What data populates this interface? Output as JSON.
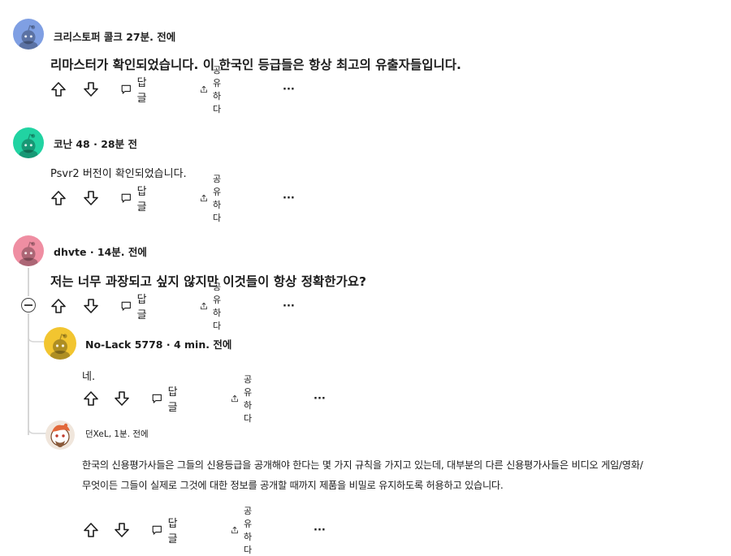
{
  "comments": [
    {
      "author": "크리스토퍼 콜크",
      "meta": "27분. 전에",
      "body": "리마스터가 확인되었습니다. 이 한국인 등급들은 항상 최고의 유출자들입니다.",
      "avatar_color": "#7f9fe3",
      "actions": {
        "reply": "답글",
        "share": "공유하다",
        "more": "···"
      }
    },
    {
      "author": "코난 48",
      "meta": "· 28분 전",
      "body": "Psvr2 버전이 확인되었습니다.",
      "avatar_color": "#21d3a2",
      "actions": {
        "reply": "답글",
        "share": "공유하다",
        "more": "···"
      }
    },
    {
      "author": "dhvte",
      "meta": "· 14분. 전에",
      "body": "저는 너무 과장되고 싶지 않지만 이것들이 항상 정확한가요?",
      "avatar_color": "#ef8ea2",
      "actions": {
        "reply": "답글",
        "share": "공유하다",
        "more": "···"
      }
    },
    {
      "author": "No-Lack 5778",
      "meta": "· 4 min. 전에",
      "body": "네.",
      "avatar_color": "#f2c530",
      "actions": {
        "reply": "답글",
        "share": "공유하다",
        "more": "···"
      }
    },
    {
      "author": "던XeL,",
      "meta": "1분. 전에",
      "body_line1": "한국의 신용평가사들은 그들의 신용등급을 공개해야 한다는 몇 가지 규칙을 가지고 있는데, 대부분의 다른 신용평가사들은 비디오 게임/영화/",
      "body_line2": "무엇이든 그들이 실제로 그것에 대한 정보를 공개할 때까지 제품을 비밀로 유지하도록 허용하고 있습니다.",
      "avatar_color": "#f0e6dc",
      "actions": {
        "reply": "답글",
        "share": "공유하다",
        "more": "···"
      }
    }
  ]
}
